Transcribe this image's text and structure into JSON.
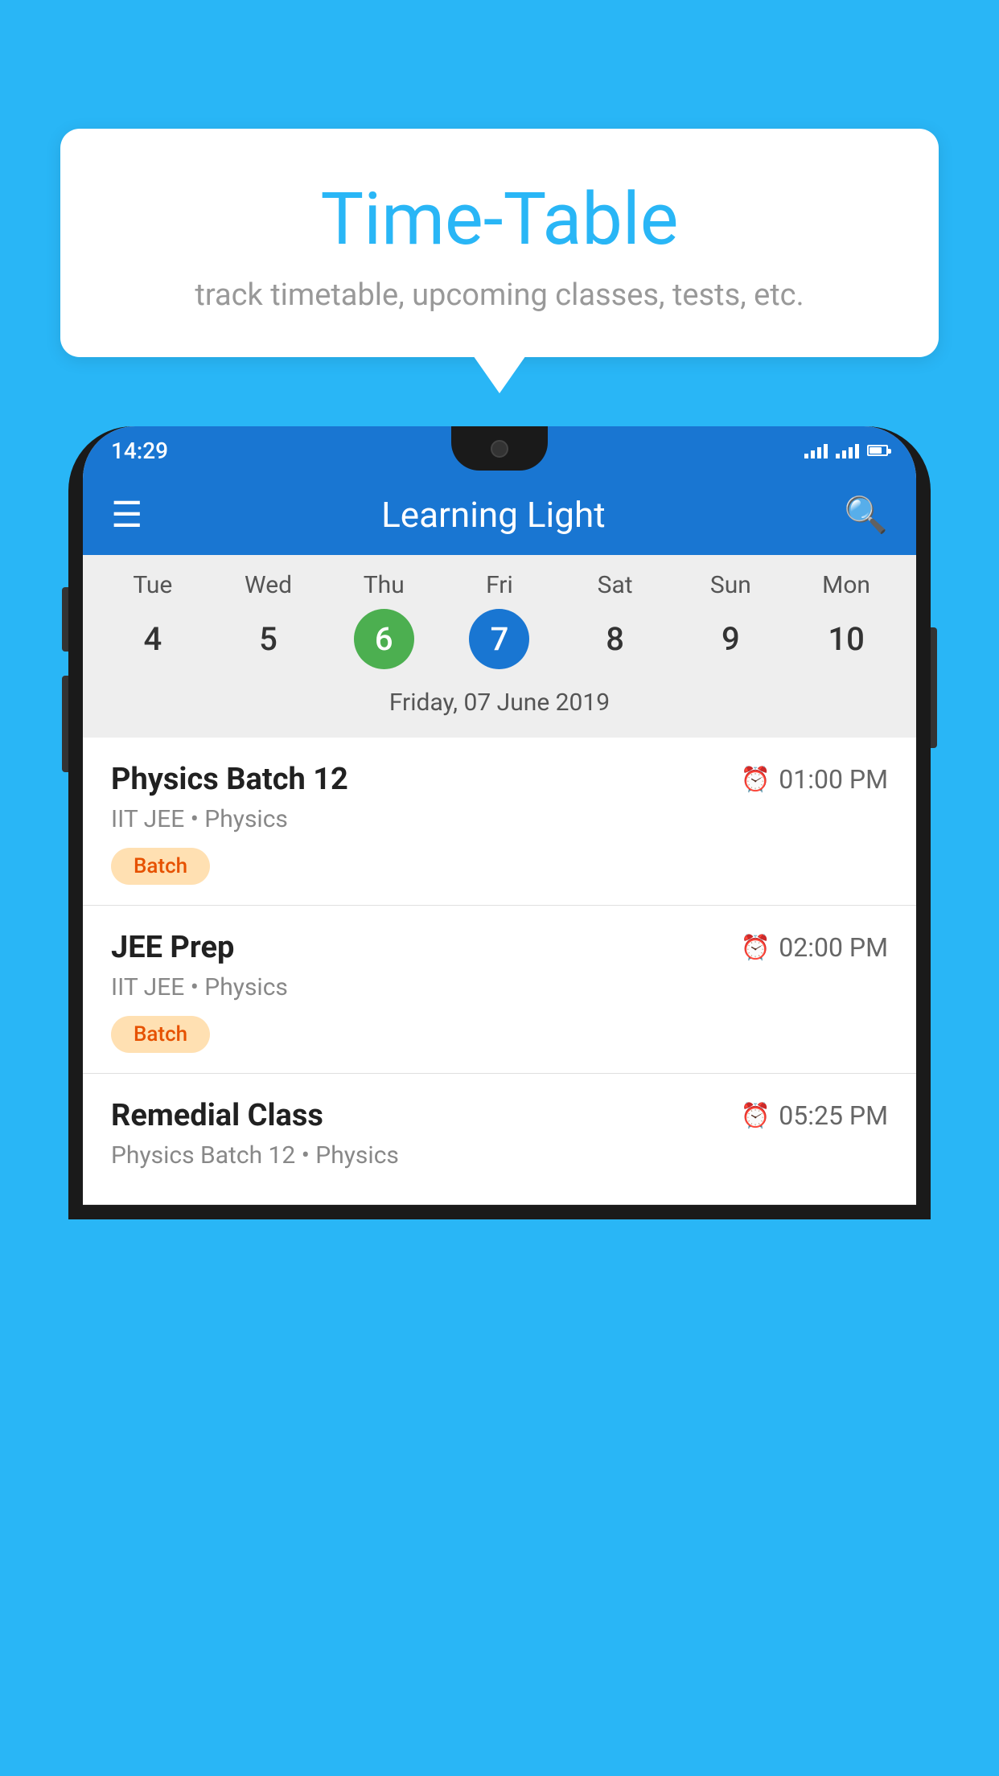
{
  "background_color": "#29B6F6",
  "speech_bubble": {
    "title": "Time-Table",
    "subtitle": "track timetable, upcoming classes, tests, etc."
  },
  "phone": {
    "status_bar": {
      "time": "14:29"
    },
    "app_bar": {
      "title": "Learning Light"
    },
    "calendar": {
      "days": [
        {
          "name": "Tue",
          "number": "4",
          "state": "normal"
        },
        {
          "name": "Wed",
          "number": "5",
          "state": "normal"
        },
        {
          "name": "Thu",
          "number": "6",
          "state": "today"
        },
        {
          "name": "Fri",
          "number": "7",
          "state": "selected"
        },
        {
          "name": "Sat",
          "number": "8",
          "state": "normal"
        },
        {
          "name": "Sun",
          "number": "9",
          "state": "normal"
        },
        {
          "name": "Mon",
          "number": "10",
          "state": "normal"
        }
      ],
      "selected_date_label": "Friday, 07 June 2019"
    },
    "schedule": [
      {
        "title": "Physics Batch 12",
        "time": "01:00 PM",
        "subtitle": "IIT JEE • Physics",
        "badge": "Batch"
      },
      {
        "title": "JEE Prep",
        "time": "02:00 PM",
        "subtitle": "IIT JEE • Physics",
        "badge": "Batch"
      },
      {
        "title": "Remedial Class",
        "time": "05:25 PM",
        "subtitle": "Physics Batch 12 • Physics",
        "badge": null
      }
    ]
  }
}
